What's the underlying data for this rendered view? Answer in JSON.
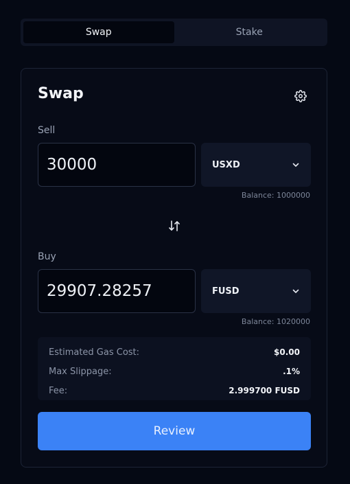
{
  "tabs": [
    {
      "label": "Swap",
      "active": true
    },
    {
      "label": "Stake",
      "active": false
    }
  ],
  "card": {
    "title": "Swap",
    "settings_icon": "gear-icon"
  },
  "sell": {
    "label": "Sell",
    "amount": "30000",
    "token": "USXD",
    "balance": "Balance: 1000000"
  },
  "switch_icon": "swap-direction-icon",
  "buy": {
    "label": "Buy",
    "amount": "29907.28257",
    "token": "FUSD",
    "balance": "Balance: 1020000"
  },
  "details": [
    {
      "label": "Estimated Gas Cost:",
      "value": "$0.00"
    },
    {
      "label": "Max Slippage:",
      "value": ".1%"
    },
    {
      "label": "Fee:",
      "value": "2.999700 FUSD"
    }
  ],
  "review_label": "Review",
  "colors": {
    "background": "#050914",
    "card": "#070b17",
    "accent": "#3b82f6"
  }
}
